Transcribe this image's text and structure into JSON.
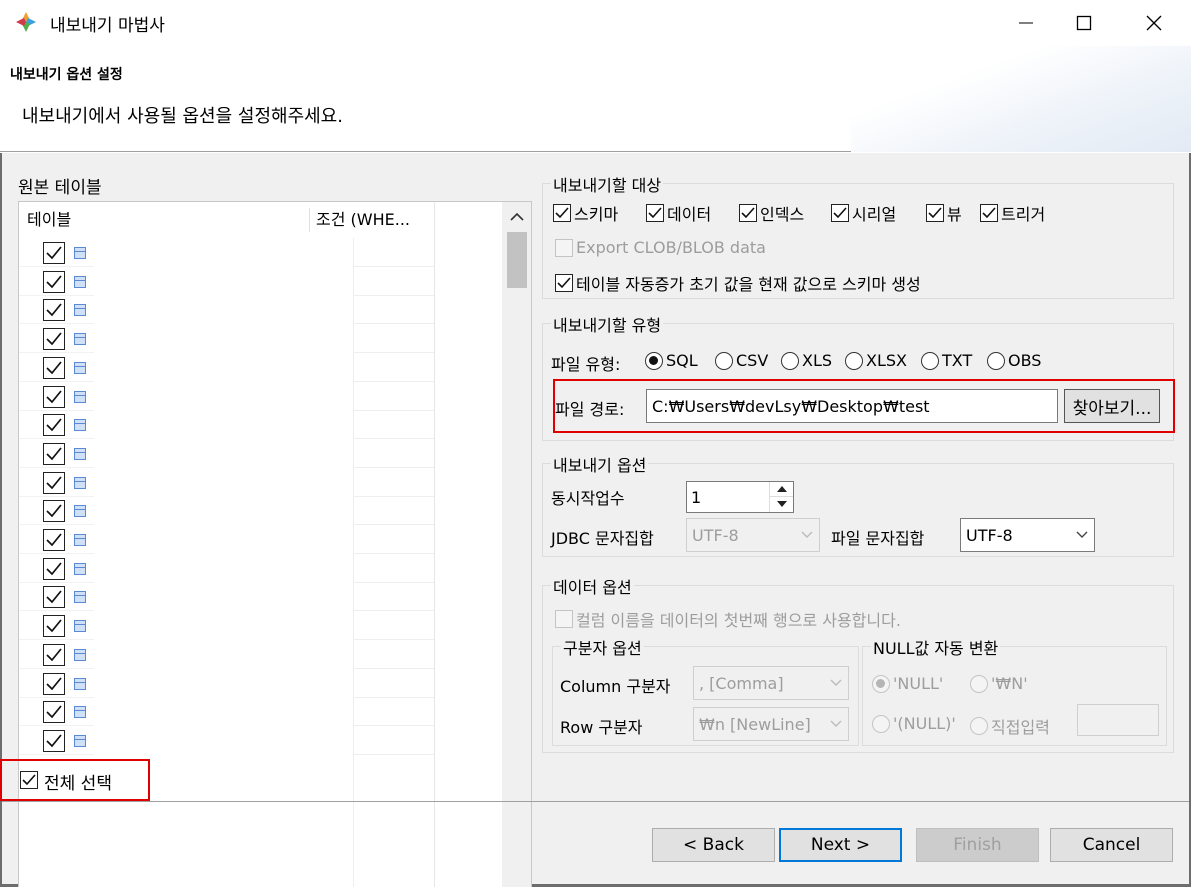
{
  "window": {
    "title": "내보내기 마법사",
    "controls": {
      "minimize": "minimize",
      "maximize": "maximize",
      "close": "close"
    }
  },
  "header": {
    "title": "내보내기 옵션 설정",
    "description": "내보내기에서 사용될 옵션을 설정해주세요."
  },
  "source": {
    "label": "원본 테이블",
    "columns": [
      "테이블",
      "조건 (WHE..."
    ],
    "rows": [
      {
        "checked": true
      },
      {
        "checked": true
      },
      {
        "checked": true
      },
      {
        "checked": true
      },
      {
        "checked": true
      },
      {
        "checked": true
      },
      {
        "checked": true
      },
      {
        "checked": true
      },
      {
        "checked": true
      },
      {
        "checked": true
      },
      {
        "checked": true
      },
      {
        "checked": true
      },
      {
        "checked": true
      },
      {
        "checked": true
      },
      {
        "checked": true
      },
      {
        "checked": true
      },
      {
        "checked": true
      },
      {
        "checked": true
      }
    ],
    "select_all": {
      "label": "전체 선택",
      "checked": true
    }
  },
  "targets": {
    "title": "내보내기할 대상",
    "items": [
      {
        "label": "스키마",
        "checked": true
      },
      {
        "label": "데이터",
        "checked": true
      },
      {
        "label": "인덱스",
        "checked": true
      },
      {
        "label": "시리얼",
        "checked": true
      },
      {
        "label": "뷰",
        "checked": true
      },
      {
        "label": "트리거",
        "checked": true
      }
    ],
    "export_lob": {
      "label": "Export CLOB/BLOB data",
      "checked": false,
      "enabled": false
    },
    "auto_increment": {
      "label": "테이블 자동증가 초기 값을 현재 값으로 스키마 생성",
      "checked": true
    }
  },
  "type": {
    "title": "내보내기할 유형",
    "file_type_label": "파일 유형:",
    "options": [
      "SQL",
      "CSV",
      "XLS",
      "XLSX",
      "TXT",
      "OBS"
    ],
    "selected": "SQL",
    "path_label": "파일 경로:",
    "path_value": "C:₩Users₩devLsy₩Desktop₩test",
    "browse_label": "찾아보기..."
  },
  "options": {
    "title": "내보내기 옵션",
    "threads_label": "동시작업수",
    "threads_value": "1",
    "jdbc_charset_label": "JDBC 문자집합",
    "jdbc_charset_value": "UTF-8",
    "file_charset_label": "파일 문자집합",
    "file_charset_value": "UTF-8"
  },
  "data_options": {
    "title": "데이터 옵션",
    "column_header": {
      "label": "컬럼 이름을 데이터의 첫번째 행으로 사용합니다.",
      "checked": false,
      "enabled": false
    },
    "delimiter": {
      "title": "구분자 옵션",
      "column_label": "Column 구분자",
      "column_value": ", [Comma]",
      "row_label": "Row 구분자",
      "row_value": "₩n [NewLine]"
    },
    "null_conv": {
      "title": "NULL값 자동 변환",
      "options": [
        "'NULL'",
        "'₩N'",
        "'(NULL)'",
        "직접입력"
      ],
      "selected": "'NULL'"
    }
  },
  "footer": {
    "back": "< Back",
    "next": "Next >",
    "finish": "Finish",
    "cancel": "Cancel"
  },
  "colors": {
    "highlight": "#e00000",
    "focus": "#0078d7"
  }
}
